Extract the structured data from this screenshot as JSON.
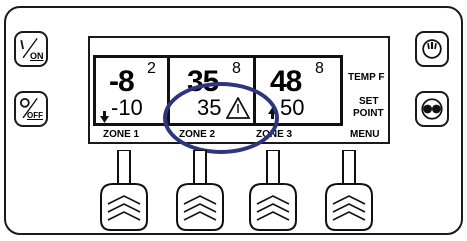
{
  "buttons": {
    "on_label": "ON",
    "off_label": "OFF"
  },
  "zones": [
    {
      "big": "-8",
      "sup": "2",
      "small": "-10",
      "label": "ZONE 1"
    },
    {
      "big": "35",
      "sup": "8",
      "small": "35",
      "label": "ZONE 2"
    },
    {
      "big": "48",
      "sup": "8",
      "small": "50",
      "label": "ZONE 3"
    }
  ],
  "right_panel": {
    "temp_label": "TEMP F",
    "set_label": "SET",
    "point_label": "POINT",
    "menu_label": "MENU"
  },
  "icons": {
    "zone1_indicator": "down-arrow-icon",
    "zone2_indicator": "warning-triangle-icon",
    "zone3_indicator": "up-arrow-icon"
  },
  "highlight_color": "#2d3580"
}
